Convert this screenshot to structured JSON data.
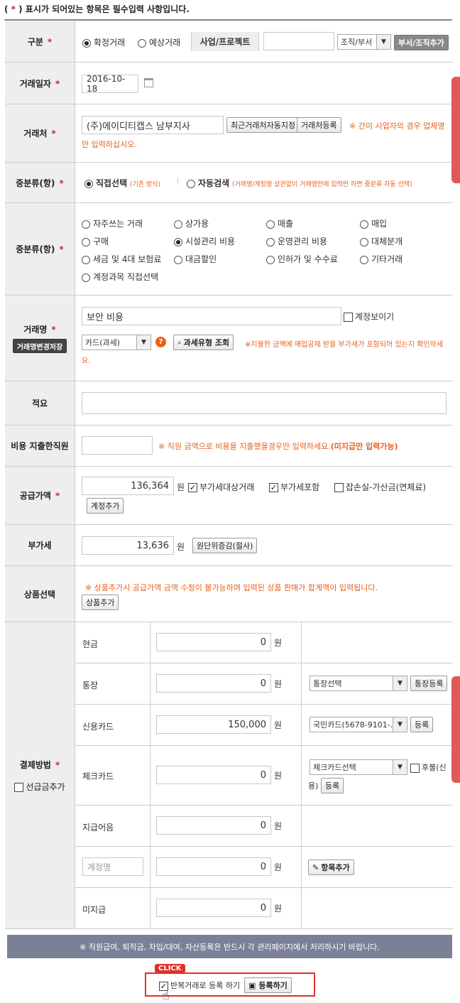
{
  "notice": {
    "prefix": "(",
    "star": "*",
    "suffix": ") 표시가 되어있는 항목은 필수입력 사항입니다."
  },
  "required_mark": "*",
  "type_row": {
    "label": "구분",
    "radio1": "확정거래",
    "radio2": "예상거래",
    "project_label": "사업/프로젝트",
    "project_value": "",
    "dept_select": "조직/부서",
    "dept_button": "부서/조직추가"
  },
  "date_row": {
    "label": "거래일자",
    "value": "2016-10-18"
  },
  "vendor_row": {
    "label": "거래처",
    "value": "(주)에이디티캡스 남부지사",
    "recent_button": "최근거래처자동지정",
    "register_button": "거래처등록",
    "note_line1": "※ 간이 사업자의 경우 업체명",
    "note_line2": "만 입력하십시오."
  },
  "class_mode_row": {
    "label": "중분류(항)",
    "direct_label": "직접선택",
    "direct_note": "(기존 방식)",
    "separator": "|",
    "auto_label": "자동검색",
    "auto_note": "(거래명/계정명 상관없이 거래명란에 입력만 하면 중분류 자동 선택)"
  },
  "class_row": {
    "label": "중분류(항)",
    "options": [
      "자주쓰는 거래",
      "상가용",
      "매출",
      "매입",
      "구매",
      "시설관리 비용",
      "운영관리 비용",
      "대체분개",
      "세금 및 4대 보험료",
      "대금할인",
      "인허가 및 수수료",
      "기타거래",
      "계정과목 직접선택"
    ]
  },
  "deal_row": {
    "label": "거래명",
    "save_button": "거래명변경저장",
    "value": "보안 비용",
    "show_account": "계정보이기",
    "tax_select": "카드(과세)",
    "help_icon": "?",
    "tax_lookup_button": "과세유형 조회",
    "note_line1": "※지불한 금액에 매입공제 받을 부가세가 포함되어 있는지 확인하세",
    "note_line2": "요."
  },
  "memo_row": {
    "label": "적요",
    "value": ""
  },
  "staff_row": {
    "label": "비용 지출한직원",
    "note_a": "※ 직원 금액으로 비용을 지출했을경우만 입력하세요.",
    "note_b": "(미지급만 입력가능)"
  },
  "supply_row": {
    "label": "공급가액",
    "value": "136,364",
    "unit": "원",
    "vat_target": "부가세대상거래",
    "vat_included": "부가세포함",
    "misc_loss": "잡손실-가산금(연체료)",
    "add_account_button": "계정추가"
  },
  "vat_row": {
    "label": "부가세",
    "value": "13,636",
    "unit": "원",
    "round_button": "원단위증감(절사)"
  },
  "product_row": {
    "label": "상품선택",
    "note": "※ 상품추가시 공급가액 금액 수정이 불가능하며 입력된 상품 판매가 합계액이 입력됩니다.",
    "add_button": "상품추가"
  },
  "payment": {
    "label": "결제방법",
    "prepay_label": "선급금추가",
    "rows": [
      {
        "name": "현금",
        "amount": "0",
        "unit": "원"
      },
      {
        "name": "통장",
        "amount": "0",
        "unit": "원",
        "select": "통장선택",
        "button": "통장등록"
      },
      {
        "name": "신용카드",
        "amount": "150,000",
        "unit": "원",
        "select": "국민카드(5678-9101-...",
        "button": "등록"
      },
      {
        "name": "체크카드",
        "amount": "0",
        "unit": "원",
        "select": "체크카드선택",
        "later_label": "후불(신",
        "later_label2": "용)",
        "button": "등록"
      },
      {
        "name": "지급어음",
        "amount": "0",
        "unit": "원"
      },
      {
        "name_placeholder": "계정명",
        "amount": "0",
        "unit": "원",
        "button": "항목추가"
      },
      {
        "name": "미지급",
        "amount": "0",
        "unit": "원"
      }
    ]
  },
  "footer_notice": "※ 직원급여, 퇴직금, 차입/대여, 자산등록은 반드시 각 관리페이지에서 처리하시기 바랍니다.",
  "submit": {
    "click_badge": "CLICK",
    "repeat_label": "반복거래로 등록 하기",
    "register_button": "등록하기"
  },
  "colors": {
    "required": "#d2232a",
    "note": "#e8601c",
    "label_bg": "#eeeeee",
    "footer_bg": "#7a8197",
    "highlight": "#e0302a"
  }
}
